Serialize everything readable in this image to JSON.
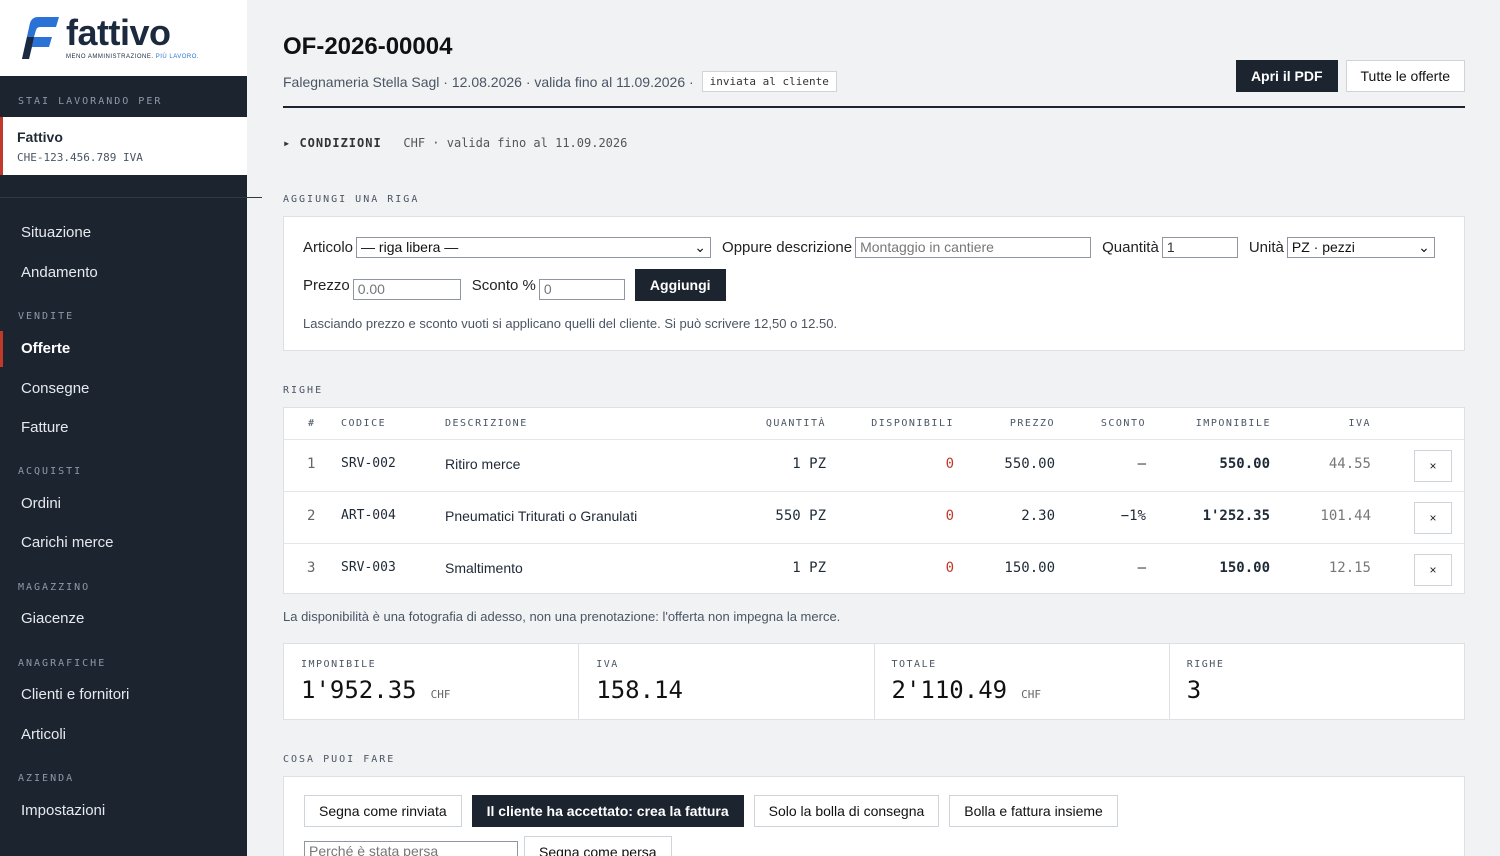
{
  "brand": {
    "name": "fattivo",
    "tagline_part1": "MENO AMMINISTRAZIONE.",
    "tagline_part2": "PIÙ LAVORO."
  },
  "sidebar": {
    "working_for_label": "STAI LAVORANDO PER",
    "company_name": "Fattivo",
    "company_vat": "CHE-123.456.789 IVA",
    "items": [
      {
        "label": "Situazione"
      },
      {
        "label": "Andamento"
      },
      {
        "section": "VENDITE"
      },
      {
        "label": "Offerte",
        "active": true
      },
      {
        "label": "Consegne"
      },
      {
        "label": "Fatture"
      },
      {
        "section": "ACQUISTI"
      },
      {
        "label": "Ordini"
      },
      {
        "label": "Carichi merce"
      },
      {
        "section": "MAGAZZINO"
      },
      {
        "label": "Giacenze"
      },
      {
        "section": "ANAGRAFICHE"
      },
      {
        "label": "Clienti e fornitori"
      },
      {
        "label": "Articoli"
      },
      {
        "section": "AZIENDA"
      },
      {
        "label": "Impostazioni"
      }
    ]
  },
  "header": {
    "title": "OF-2026-00004",
    "subtitle": "Falegnameria Stella Sagl · 12.08.2026 · valida fino al 11.09.2026 ·",
    "status": "inviata al cliente",
    "pdf_button": "Apri il PDF",
    "all_offers_button": "Tutte le offerte"
  },
  "conditions": {
    "toggle": "▸ CONDIZIONI",
    "summary": "CHF · valida fino al 11.09.2026"
  },
  "add_row": {
    "section_label": "AGGIUNGI UNA RIGA",
    "article_label": "Articolo",
    "article_value": "— riga libera —",
    "description_label": "Oppure descrizione",
    "description_placeholder": "Montaggio in cantiere",
    "quantity_label": "Quantità",
    "quantity_value": "1",
    "unit_label": "Unità",
    "unit_value": "PZ · pezzi",
    "price_label": "Prezzo",
    "price_placeholder": "0.00",
    "discount_label": "Sconto %",
    "discount_placeholder": "0",
    "add_button": "Aggiungi",
    "hint": "Lasciando prezzo e sconto vuoti si applicano quelli del cliente. Si può scrivere 12,50 o 12.50."
  },
  "rows_section": {
    "label": "RIGHE",
    "columns": [
      "#",
      "CODICE",
      "DESCRIZIONE",
      "QUANTITÀ",
      "DISPONIBILI",
      "PREZZO",
      "SCONTO",
      "IMPONIBILE",
      "IVA"
    ],
    "rows": [
      {
        "n": "1",
        "code": "SRV-002",
        "desc": "Ritiro merce",
        "qty": "1 PZ",
        "avail": "0",
        "price": "550.00",
        "discount": "—",
        "net": "550.00",
        "vat": "44.55",
        "delete": "×"
      },
      {
        "n": "2",
        "code": "ART-004",
        "desc": "Pneumatici Triturati o Granulati",
        "qty": "550 PZ",
        "avail": "0",
        "price": "2.30",
        "discount": "−1%",
        "net": "1'252.35",
        "vat": "101.44",
        "delete": "×"
      },
      {
        "n": "3",
        "code": "SRV-003",
        "desc": "Smaltimento",
        "qty": "1 PZ",
        "avail": "0",
        "price": "150.00",
        "discount": "—",
        "net": "150.00",
        "vat": "12.15",
        "delete": "×"
      }
    ],
    "note": "La disponibilità è una fotografia di adesso, non una prenotazione: l'offerta non impegna la merce."
  },
  "totals": [
    {
      "label": "IMPONIBILE",
      "value": "1'952.35",
      "currency": "CHF"
    },
    {
      "label": "IVA",
      "value": "158.14",
      "currency": ""
    },
    {
      "label": "TOTALE",
      "value": "2'110.49",
      "currency": "CHF"
    },
    {
      "label": "RIGHE",
      "value": "3",
      "currency": ""
    }
  ],
  "actions": {
    "section_label": "COSA PUOI FARE",
    "mark_postponed": "Segna come rinviata",
    "accept_invoice": "Il cliente ha accettato: crea la fattura",
    "delivery_only": "Solo la bolla di consegna",
    "delivery_and_invoice": "Bolla e fattura insieme",
    "lost_reason_placeholder": "Perché è stata persa",
    "mark_lost": "Segna come persa"
  },
  "colors": {
    "sidebar_bg": "#1c2430",
    "accent_red": "#c0392b",
    "logo_blue": "#2a72d6",
    "availability_red": "#c0392b"
  }
}
